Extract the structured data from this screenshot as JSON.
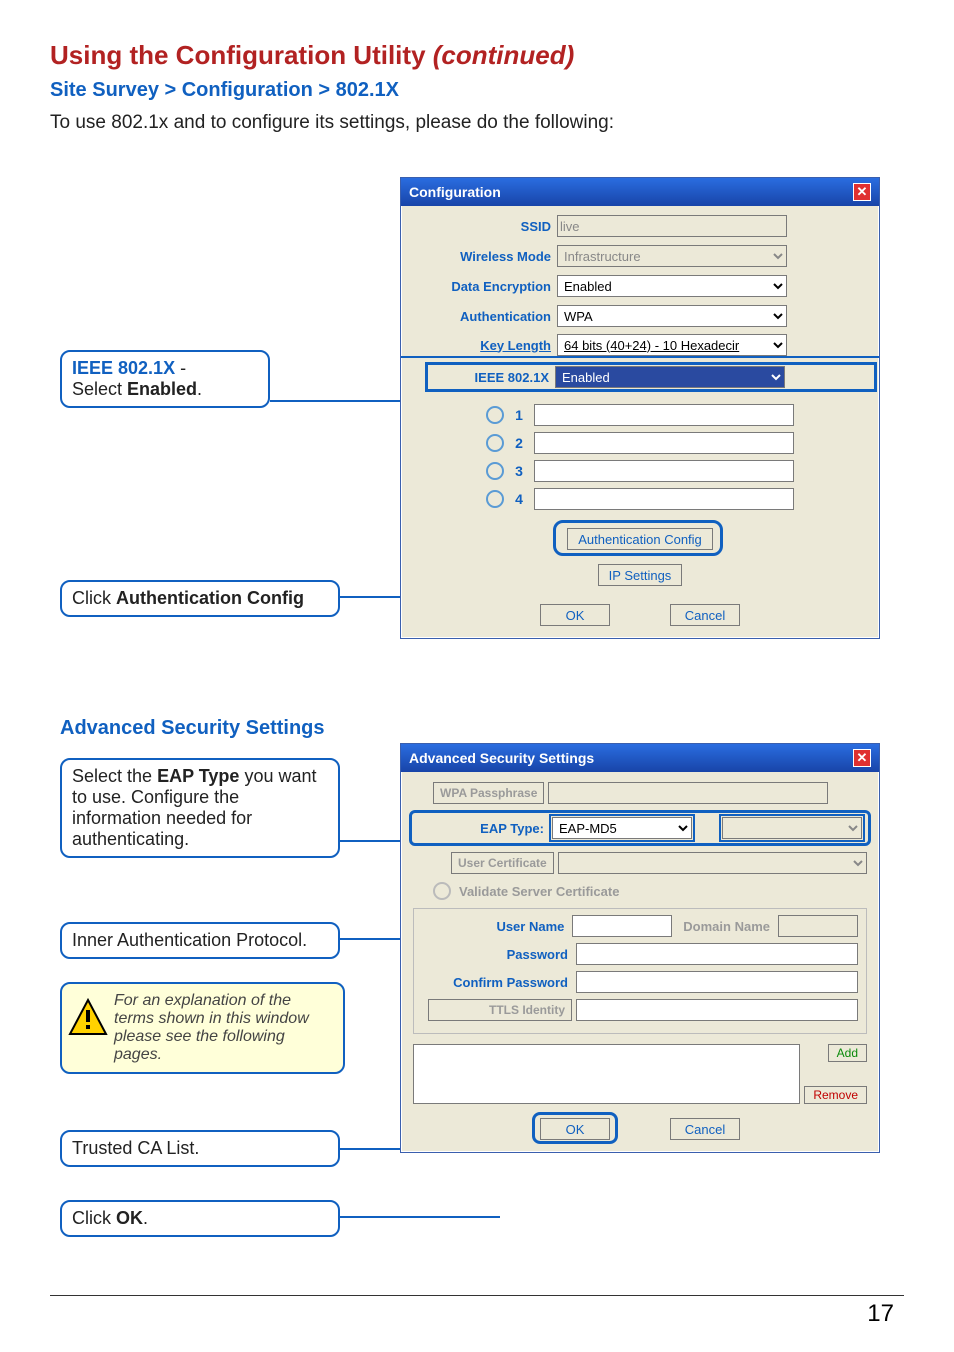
{
  "header": {
    "title_main": "Using the Configuration Utility ",
    "title_cont": "(continued)",
    "breadcrumb": "Site Survey > Configuration > 802.1X",
    "intro": "To use 802.1x and to configure its settings, please do the following:"
  },
  "callouts": {
    "ieee_pre": "IEEE 802.1X",
    "ieee_sep": " - ",
    "ieee_post1": "Select ",
    "ieee_post2": "Enabled",
    "ieee_post3": ".",
    "auth_pre": "Click ",
    "auth_bold": "Authentication Config",
    "eap1": "Select the ",
    "eap2": "EAP Type",
    "eap3": " you want to use. Configure the information needed for authenticating.",
    "inner_auth": "Inner Authentication Protocol.",
    "note": "For an explanation of the terms shown in this window please see the following pages.",
    "trusted_ca": "Trusted CA List.",
    "click_ok_pre": "Click ",
    "click_ok_bold": "OK",
    "click_ok_post": "."
  },
  "adv_section_title": "Advanced Security Settings",
  "config_win": {
    "title": "Configuration",
    "labels": {
      "ssid": "SSID",
      "wireless_mode": "Wireless Mode",
      "data_encryption": "Data Encryption",
      "authentication": "Authentication",
      "key_length": "Key Length",
      "ieee8021x": "IEEE 802.1X"
    },
    "values": {
      "ssid": "live",
      "wireless_mode": "Infrastructure",
      "data_encryption": "Enabled",
      "authentication": "WPA",
      "key_length": "64 bits (40+24) - 10 Hexadecir",
      "ieee8021x": "Enabled"
    },
    "keys": [
      "1",
      "2",
      "3",
      "4"
    ],
    "buttons": {
      "auth_config": "Authentication Config",
      "ip_settings": "IP Settings",
      "ok": "OK",
      "cancel": "Cancel"
    }
  },
  "adv_win": {
    "title": "Advanced Security Settings",
    "labels": {
      "wpa_pass": "WPA Passphrase",
      "eap_type": "EAP Type:",
      "user_cert": "User Certificate",
      "validate": "Validate Server Certificate",
      "user_name": "User Name",
      "domain_name": "Domain Name",
      "password": "Password",
      "confirm_password": "Confirm Password",
      "ttls_identity": "TTLS Identity"
    },
    "values": {
      "eap_type": "EAP-MD5"
    },
    "buttons": {
      "add": "Add",
      "remove": "Remove",
      "ok": "OK",
      "cancel": "Cancel"
    }
  },
  "page_number": "17"
}
